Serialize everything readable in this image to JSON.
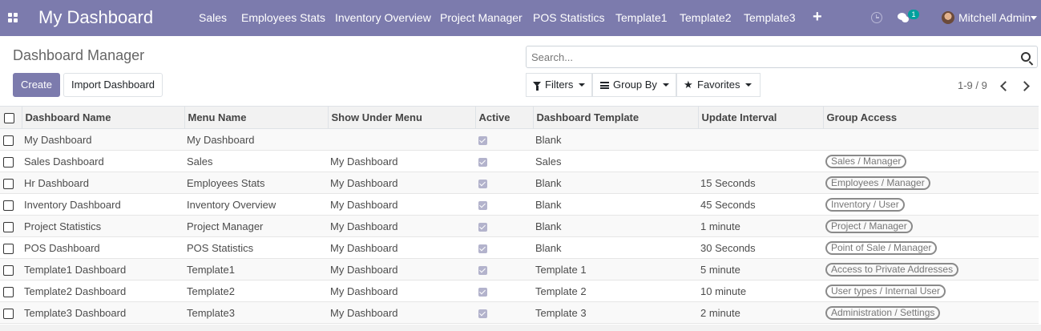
{
  "navbar": {
    "brand": "My Dashboard",
    "menu": [
      {
        "label": "Sales"
      },
      {
        "label": "Employees Stats"
      },
      {
        "label": "Inventory Overview"
      },
      {
        "label": "Project Manager"
      },
      {
        "label": "POS Statistics"
      },
      {
        "label": "Template1"
      },
      {
        "label": "Template2"
      },
      {
        "label": "Template3"
      }
    ],
    "plus_icon": "+",
    "message_count": "1",
    "user": "Mitchell Admin",
    "icons": [
      "apps-grid-icon",
      "plus-icon",
      "clock-icon",
      "chat-icon",
      "avatar",
      "caret-down-icon"
    ]
  },
  "control": {
    "title": "Dashboard Manager",
    "create_label": "Create",
    "import_label": "Import Dashboard",
    "search_placeholder": "Search...",
    "filters_label": "Filters",
    "groupby_label": "Group By",
    "favorites_label": "Favorites",
    "pager": "1-9 / 9"
  },
  "table": {
    "headers": [
      "Dashboard Name",
      "Menu Name",
      "Show Under Menu",
      "Active",
      "Dashboard Template",
      "Update Interval",
      "Group Access"
    ],
    "rows": [
      {
        "name": "My Dashboard",
        "menu": "My Dashboard",
        "under": "",
        "active": true,
        "template": "Blank",
        "interval": "",
        "access": ""
      },
      {
        "name": "Sales Dashboard",
        "menu": "Sales",
        "under": "My Dashboard",
        "active": true,
        "template": "Sales",
        "interval": "",
        "access": "Sales / Manager"
      },
      {
        "name": "Hr Dashboard",
        "menu": "Employees Stats",
        "under": "My Dashboard",
        "active": true,
        "template": "Blank",
        "interval": "15 Seconds",
        "access": "Employees / Manager"
      },
      {
        "name": "Inventory Dashboard",
        "menu": "Inventory Overview",
        "under": "My Dashboard",
        "active": true,
        "template": "Blank",
        "interval": "45 Seconds",
        "access": "Inventory / User"
      },
      {
        "name": "Project Statistics",
        "menu": "Project Manager",
        "under": "My Dashboard",
        "active": true,
        "template": "Blank",
        "interval": "1 minute",
        "access": "Project / Manager"
      },
      {
        "name": "POS Dashboard",
        "menu": "POS Statistics",
        "under": "My Dashboard",
        "active": true,
        "template": "Blank",
        "interval": "30 Seconds",
        "access": "Point of Sale / Manager"
      },
      {
        "name": "Template1 Dashboard",
        "menu": "Template1",
        "under": "My Dashboard",
        "active": true,
        "template": "Template 1",
        "interval": "5 minute",
        "access": "Access to Private Addresses"
      },
      {
        "name": "Template2 Dashboard",
        "menu": "Template2",
        "under": "My Dashboard",
        "active": true,
        "template": "Template 2",
        "interval": "10 minute",
        "access": "User types / Internal User"
      },
      {
        "name": "Template3 Dashboard",
        "menu": "Template3",
        "under": "My Dashboard",
        "active": true,
        "template": "Template 3",
        "interval": "2 minute",
        "access": "Administration / Settings"
      }
    ]
  },
  "colors": {
    "navbar": "#7c7bad",
    "primary": "#7c7bad",
    "badge": "#00a09d"
  }
}
